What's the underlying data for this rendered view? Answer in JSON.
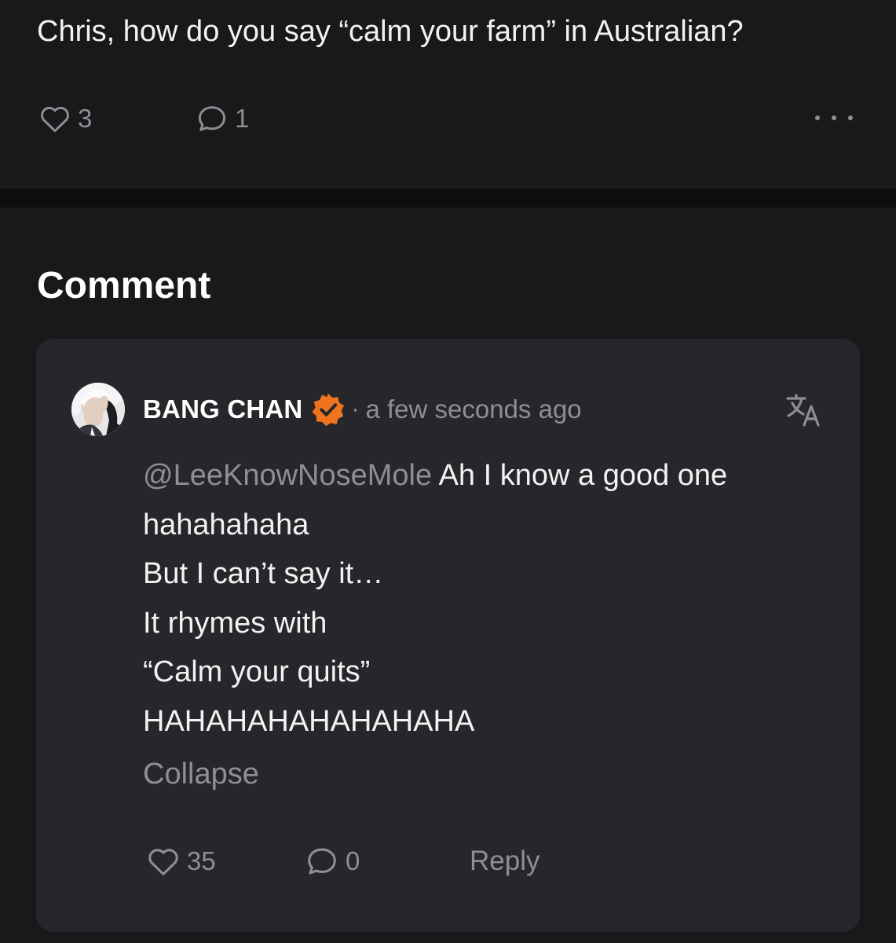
{
  "post": {
    "text": "Chris, how do you say “calm your farm” in Australian?",
    "like_count": "3",
    "comment_count": "1"
  },
  "comments": {
    "heading": "Comment",
    "items": [
      {
        "author": "BANG CHAN",
        "verified": true,
        "separator": "·",
        "timestamp": "a few seconds ago",
        "mention": "@LeeKnowNoseMole",
        "lines": [
          "Ah I know a good one",
          "hahahahaha",
          "But I can’t say it…",
          "It rhymes with",
          "“Calm your quits”",
          "HAHAHAHAHAHAHAHA"
        ],
        "collapse_label": "Collapse",
        "like_count": "35",
        "reply_count": "0",
        "reply_label": "Reply"
      }
    ]
  },
  "icons": {
    "like": "heart-icon",
    "comment": "speech-bubble-icon",
    "more": "more-dots-icon",
    "translate": "translate-icon",
    "verified": "verified-badge-icon"
  },
  "colors": {
    "background": "#19191c",
    "card": "#26262b",
    "muted_text": "#8e8e93",
    "verified_badge": "#f0741d"
  }
}
